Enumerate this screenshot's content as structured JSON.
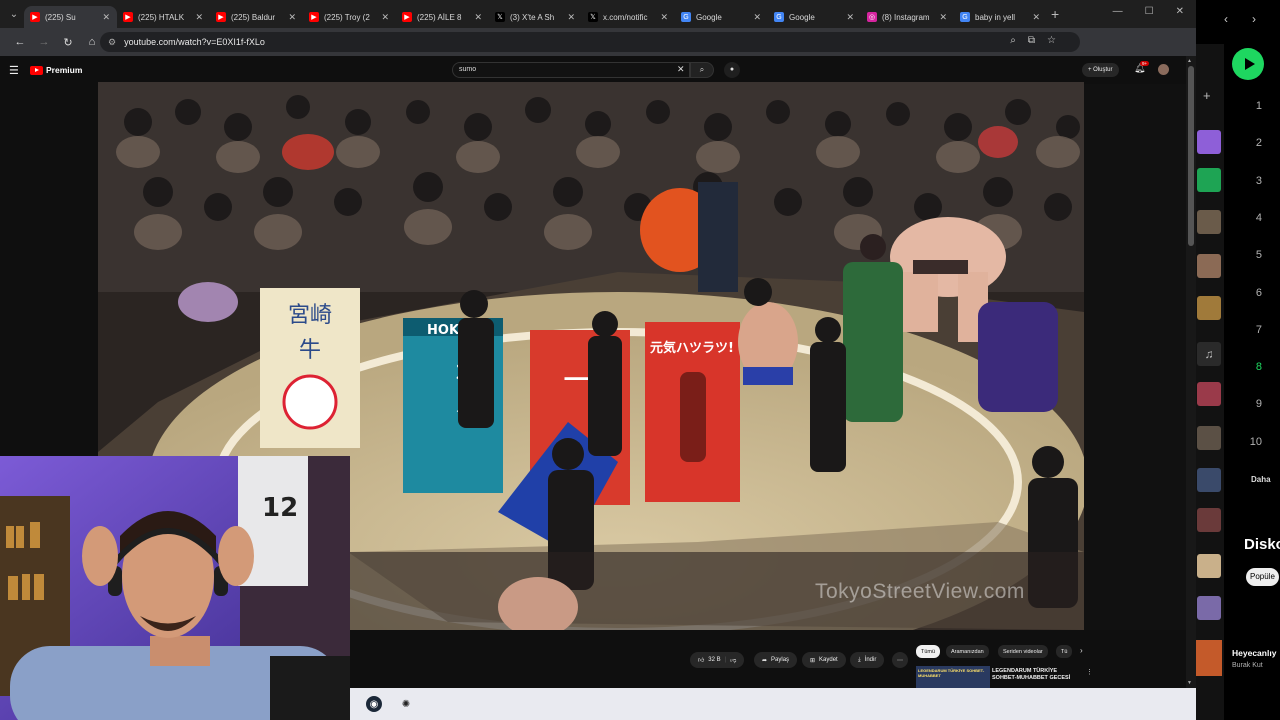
{
  "browser": {
    "tabs": [
      {
        "title": "(225) Su",
        "favicon": "youtube-icon",
        "color": "#ff0000",
        "active": true
      },
      {
        "title": "(225) HTALK",
        "favicon": "youtube-icon",
        "color": "#ff0000",
        "active": false
      },
      {
        "title": "(225) Baldur",
        "favicon": "youtube-icon",
        "color": "#ff0000",
        "active": false
      },
      {
        "title": "(225) Troy (2",
        "favicon": "youtube-icon",
        "color": "#ff0000",
        "active": false
      },
      {
        "title": "(225) AİLE 8",
        "favicon": "youtube-icon",
        "color": "#ff0000",
        "active": false
      },
      {
        "title": "(3) X'te A Sh",
        "favicon": "x-icon",
        "color": "#000000",
        "active": false
      },
      {
        "title": "x.com/notific",
        "favicon": "x-icon",
        "color": "#000000",
        "active": false
      },
      {
        "title": "Google",
        "favicon": "google-icon",
        "color": "#4285f4",
        "active": false
      },
      {
        "title": "Google",
        "favicon": "google-icon",
        "color": "#4285f4",
        "active": false
      },
      {
        "title": "(8) Instagram",
        "favicon": "instagram-icon",
        "color": "#d6249f",
        "active": false
      },
      {
        "title": "baby in yell",
        "favicon": "google-icon",
        "color": "#4285f4",
        "active": false
      }
    ],
    "url": "youtube.com/watch?v=E0XI1f-fXLo"
  },
  "youtube": {
    "logo_label": "Premium",
    "search_value": "sumo",
    "create_label": "Oluştur",
    "notification_count": "9+",
    "watermark": "TokyoStreetView.com",
    "actions": {
      "like_count": "32 B",
      "share_label": "Paylaş",
      "save_label": "Kaydet",
      "download_label": "İndir"
    },
    "chips": [
      "Tümü",
      "Aramanızdan",
      "Seriden videolar",
      "Tü"
    ],
    "recommendation": {
      "thumb_text": "LEGENDARUM TÜRKİYE SOHBET-MUHABBET",
      "title_line1": "LEGENDARUM TÜRKİYE",
      "title_line2": "SOHBET-MUHABBET GECESİ"
    }
  },
  "spotify": {
    "numbers": [
      "1",
      "2",
      "3",
      "4",
      "5",
      "6",
      "7",
      "8",
      "9",
      "10"
    ],
    "playing_index": 7,
    "show_more": "Daha",
    "discover": "Disko",
    "popular_chip": "Popüle",
    "now_playing": {
      "title": "Heyecanlıy",
      "artist": "Burak Kut"
    }
  },
  "colors": {
    "accent_red": "#ff0000",
    "spotify_green": "#1ed760"
  }
}
